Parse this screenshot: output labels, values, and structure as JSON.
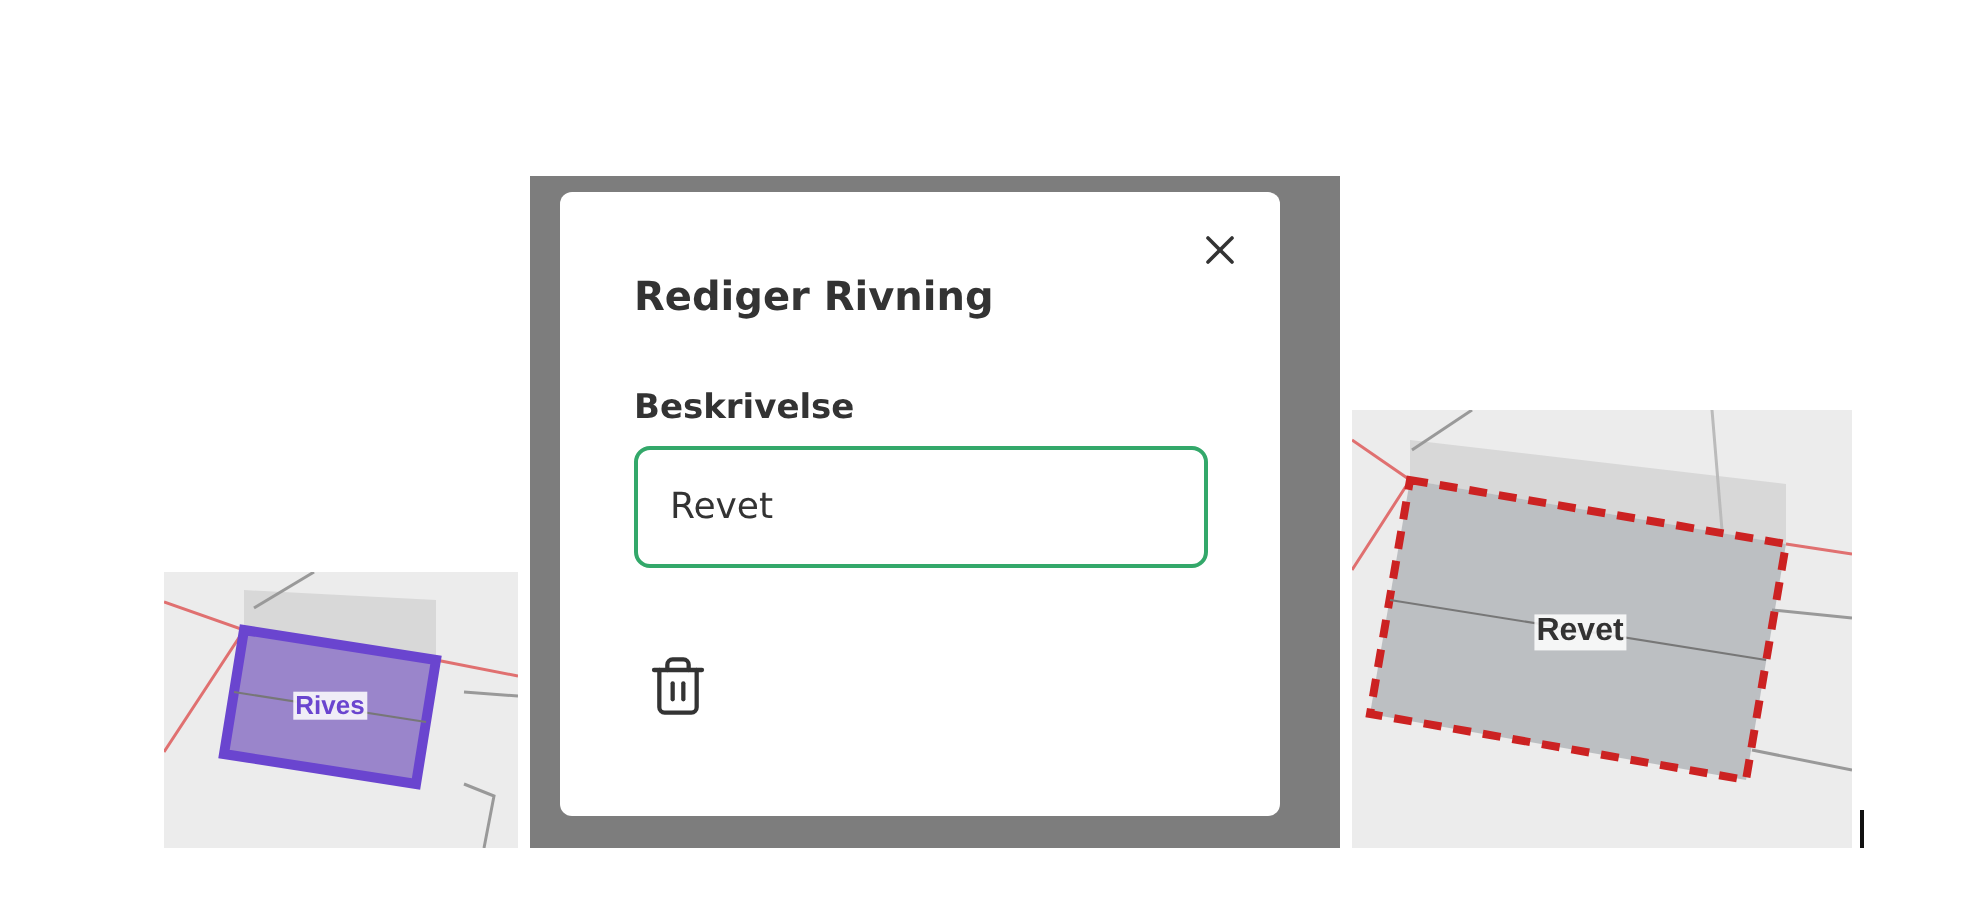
{
  "maps": [
    {
      "kind": "picture",
      "demolished": false,
      "label": "Rives"
    },
    {
      "kind": "picture",
      "demolished": true,
      "label": "Revet"
    }
  ],
  "dialog": {
    "title": "Rediger Rivning",
    "field": {
      "label": "Beskrivelse",
      "value": "Revet",
      "focused": true
    }
  }
}
